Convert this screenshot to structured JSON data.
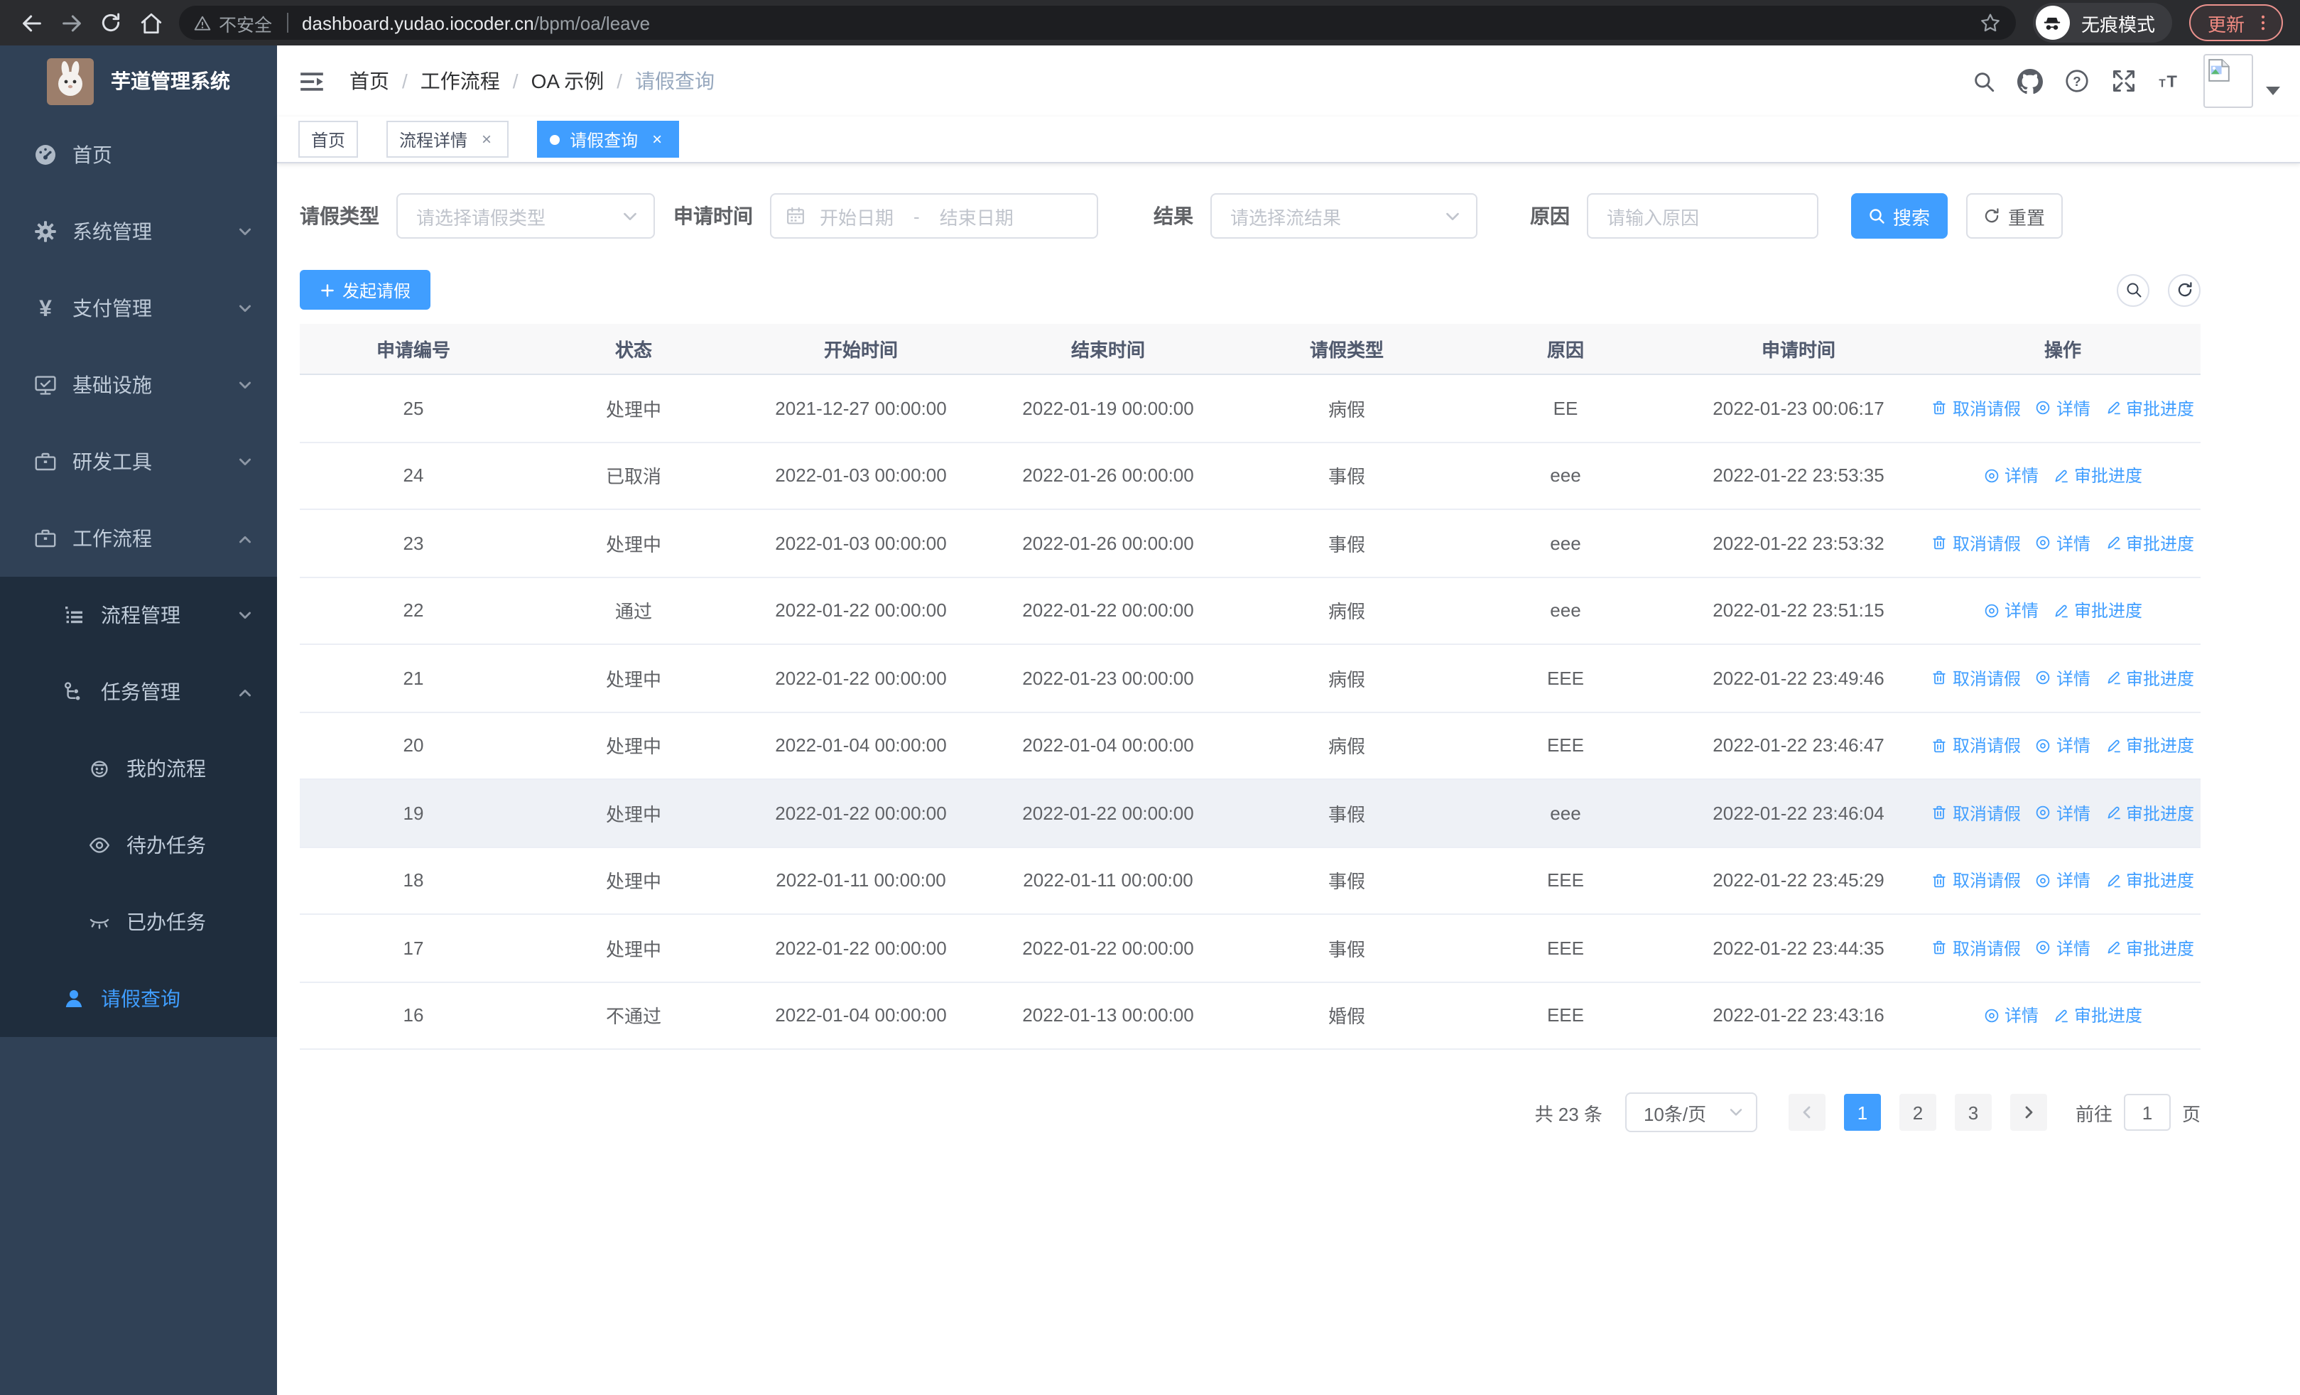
{
  "browser": {
    "security_label": "不安全",
    "url_host": "dashboard.yudao.iocoder.cn",
    "url_path": "/bpm/oa/leave",
    "incognito_label": "无痕模式",
    "update_label": "更新"
  },
  "sidebar": {
    "title": "芋道管理系统",
    "items": [
      {
        "label": "首页",
        "icon": "dashboard-icon"
      },
      {
        "label": "系统管理",
        "icon": "gear-icon"
      },
      {
        "label": "支付管理",
        "icon": "yen-icon"
      },
      {
        "label": "基础设施",
        "icon": "monitor-icon"
      },
      {
        "label": "研发工具",
        "icon": "briefcase-icon"
      },
      {
        "label": "工作流程",
        "icon": "briefcase-icon"
      },
      {
        "label": "流程管理",
        "icon": "list-tree-icon"
      },
      {
        "label": "任务管理",
        "icon": "flow-tree-icon"
      },
      {
        "label": "我的流程",
        "icon": "robot-icon"
      },
      {
        "label": "待办任务",
        "icon": "eye-open-icon"
      },
      {
        "label": "已办任务",
        "icon": "eye-closed-icon"
      },
      {
        "label": "请假查询",
        "icon": "user-icon"
      }
    ]
  },
  "header": {
    "breadcrumb": [
      "首页",
      "工作流程",
      "OA 示例",
      "请假查询"
    ],
    "separator": "/"
  },
  "tabs": [
    {
      "label": "首页"
    },
    {
      "label": "流程详情",
      "close": "×"
    },
    {
      "label": "请假查询",
      "close": "×"
    }
  ],
  "filters": {
    "leave_type_label": "请假类型",
    "leave_type_placeholder": "请选择请假类型",
    "apply_time_label": "申请时间",
    "start_placeholder": "开始日期",
    "range_separator": "-",
    "end_placeholder": "结束日期",
    "result_label": "结果",
    "result_placeholder": "请选择流结果",
    "reason_label": "原因",
    "reason_placeholder": "请输入原因",
    "search_label": "搜索",
    "reset_label": "重置"
  },
  "toolbar": {
    "create_label": "发起请假"
  },
  "table": {
    "columns": [
      "申请编号",
      "状态",
      "开始时间",
      "结束时间",
      "请假类型",
      "原因",
      "申请时间",
      "操作"
    ],
    "action_labels": {
      "cancel": "取消请假",
      "detail": "详情",
      "progress": "审批进度"
    },
    "rows": [
      {
        "id": "25",
        "status": "处理中",
        "start": "2021-12-27 00:00:00",
        "end": "2022-01-19 00:00:00",
        "type": "病假",
        "reason": "EE",
        "apply": "2022-01-23 00:06:17",
        "actions": [
          "cancel",
          "detail",
          "progress"
        ],
        "hover": false
      },
      {
        "id": "24",
        "status": "已取消",
        "start": "2022-01-03 00:00:00",
        "end": "2022-01-26 00:00:00",
        "type": "事假",
        "reason": "eee",
        "apply": "2022-01-22 23:53:35",
        "actions": [
          "detail",
          "progress"
        ],
        "hover": false
      },
      {
        "id": "23",
        "status": "处理中",
        "start": "2022-01-03 00:00:00",
        "end": "2022-01-26 00:00:00",
        "type": "事假",
        "reason": "eee",
        "apply": "2022-01-22 23:53:32",
        "actions": [
          "cancel",
          "detail",
          "progress"
        ],
        "hover": false
      },
      {
        "id": "22",
        "status": "通过",
        "start": "2022-01-22 00:00:00",
        "end": "2022-01-22 00:00:00",
        "type": "病假",
        "reason": "eee",
        "apply": "2022-01-22 23:51:15",
        "actions": [
          "detail",
          "progress"
        ],
        "hover": false
      },
      {
        "id": "21",
        "status": "处理中",
        "start": "2022-01-22 00:00:00",
        "end": "2022-01-23 00:00:00",
        "type": "病假",
        "reason": "EEE",
        "apply": "2022-01-22 23:49:46",
        "actions": [
          "cancel",
          "detail",
          "progress"
        ],
        "hover": false
      },
      {
        "id": "20",
        "status": "处理中",
        "start": "2022-01-04 00:00:00",
        "end": "2022-01-04 00:00:00",
        "type": "病假",
        "reason": "EEE",
        "apply": "2022-01-22 23:46:47",
        "actions": [
          "cancel",
          "detail",
          "progress"
        ],
        "hover": false
      },
      {
        "id": "19",
        "status": "处理中",
        "start": "2022-01-22 00:00:00",
        "end": "2022-01-22 00:00:00",
        "type": "事假",
        "reason": "eee",
        "apply": "2022-01-22 23:46:04",
        "actions": [
          "cancel",
          "detail",
          "progress"
        ],
        "hover": true
      },
      {
        "id": "18",
        "status": "处理中",
        "start": "2022-01-11 00:00:00",
        "end": "2022-01-11 00:00:00",
        "type": "事假",
        "reason": "EEE",
        "apply": "2022-01-22 23:45:29",
        "actions": [
          "cancel",
          "detail",
          "progress"
        ],
        "hover": false
      },
      {
        "id": "17",
        "status": "处理中",
        "start": "2022-01-22 00:00:00",
        "end": "2022-01-22 00:00:00",
        "type": "事假",
        "reason": "EEE",
        "apply": "2022-01-22 23:44:35",
        "actions": [
          "cancel",
          "detail",
          "progress"
        ],
        "hover": false
      },
      {
        "id": "16",
        "status": "不通过",
        "start": "2022-01-04 00:00:00",
        "end": "2022-01-13 00:00:00",
        "type": "婚假",
        "reason": "EEE",
        "apply": "2022-01-22 23:43:16",
        "actions": [
          "detail",
          "progress"
        ],
        "hover": false
      }
    ]
  },
  "pagination": {
    "total_label": "共 23 条",
    "page_size": "10条/页",
    "pages": [
      "1",
      "2",
      "3"
    ],
    "active_page": "1",
    "goto_label": "前往",
    "goto_value": "1",
    "page_unit": "页"
  },
  "colors": {
    "primary": "#409eff",
    "sidebar_bg": "#304156",
    "submenu_bg": "#1f2d3d",
    "sidebar_text": "#bfcbd9",
    "table_header_bg": "#f8f8f9",
    "table_header_text": "#515a6e",
    "cell_text": "#606266",
    "row_border": "#ebeef5",
    "hover_row_bg": "#eef1f6",
    "update_chip": "#f28b82"
  }
}
